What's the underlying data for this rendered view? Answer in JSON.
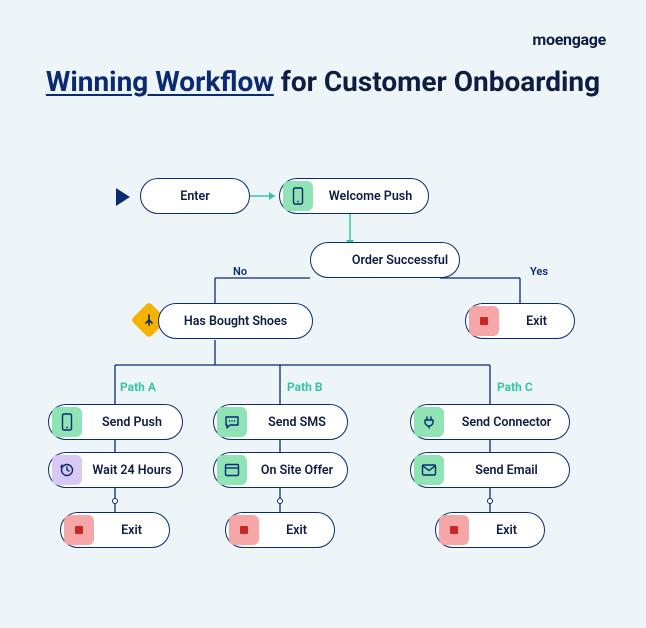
{
  "brand": "moengage",
  "title_highlight": "Winning Workflow",
  "title_rest": " for Customer Onboarding",
  "nodes": {
    "enter": "Enter",
    "welcome": "Welcome Push",
    "order": "Order Successful",
    "exit_top": "Exit",
    "shoes": "Has Bought Shoes",
    "pathA": "Path A",
    "pathB": "Path B",
    "pathC": "Path C",
    "send_push": "Send Push",
    "wait": "Wait 24 Hours",
    "exit_a": "Exit",
    "send_sms": "Send SMS",
    "onsite": "On Site Offer",
    "exit_b": "Exit",
    "connector": "Send Connector",
    "email": "Send Email",
    "exit_c": "Exit"
  },
  "labels": {
    "no": "No",
    "yes": "Yes"
  },
  "colors": {
    "accent": "#0a2a72",
    "teal": "#38c3a3",
    "yellow": "#f5b301"
  }
}
